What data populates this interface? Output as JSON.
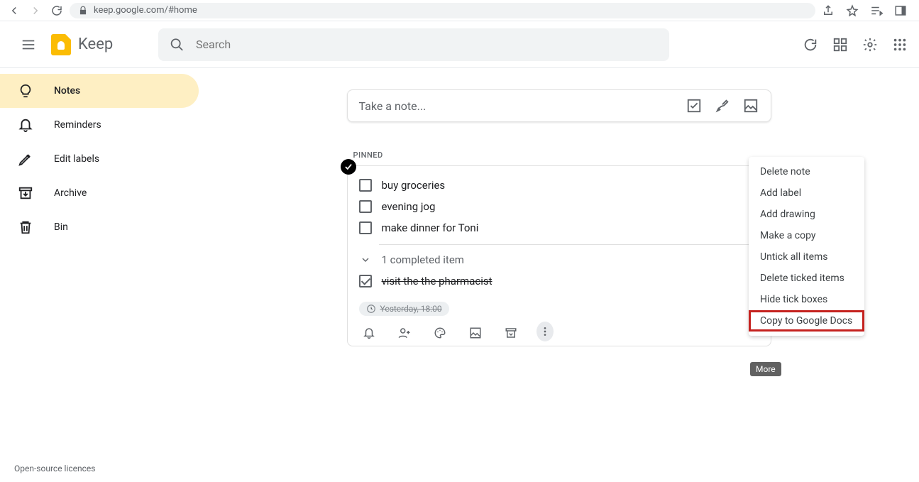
{
  "browser": {
    "url": "keep.google.com/#home"
  },
  "app": {
    "title": "Keep",
    "search_placeholder": "Search"
  },
  "sidebar": {
    "items": [
      {
        "label": "Notes",
        "icon": "bulb-icon"
      },
      {
        "label": "Reminders",
        "icon": "bell-icon"
      },
      {
        "label": "Edit labels",
        "icon": "pencil-icon"
      },
      {
        "label": "Archive",
        "icon": "archive-icon"
      },
      {
        "label": "Bin",
        "icon": "trash-icon"
      }
    ]
  },
  "take_note": {
    "placeholder": "Take a note..."
  },
  "section": {
    "pinned": "Pinned"
  },
  "note": {
    "items": [
      {
        "text": "buy groceries",
        "done": false
      },
      {
        "text": "evening jog",
        "done": false
      },
      {
        "text": "make dinner for Toni",
        "done": false
      }
    ],
    "completed_summary": "1 completed item",
    "completed_items": [
      {
        "text": "visit the the pharmacist"
      }
    ],
    "chip": "Yesterday, 18:00"
  },
  "menu": {
    "items": [
      "Delete note",
      "Add label",
      "Add drawing",
      "Make a copy",
      "Untick all items",
      "Delete ticked items",
      "Hide tick boxes",
      "Copy to Google Docs"
    ]
  },
  "tooltip": {
    "more": "More"
  },
  "footer": {
    "licences": "Open-source licences"
  }
}
